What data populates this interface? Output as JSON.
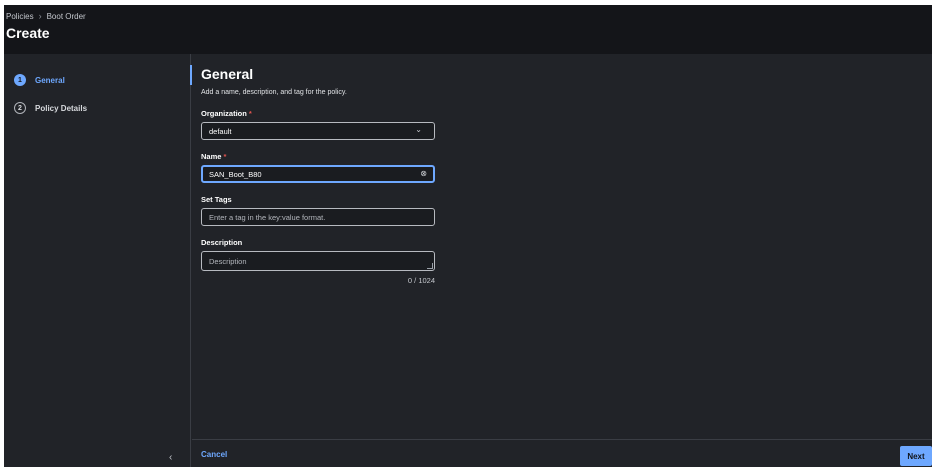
{
  "header": {
    "breadcrumb": [
      "Policies",
      "Boot Order"
    ],
    "breadcrumb_sep": "›",
    "title": "Create"
  },
  "sidebar": {
    "steps": [
      {
        "number": "1",
        "label": "General",
        "active": true
      },
      {
        "number": "2",
        "label": "Policy Details",
        "active": false
      }
    ],
    "collapse_icon": "chevron-left-icon",
    "collapse_glyph": "‹"
  },
  "main": {
    "title": "General",
    "description": "Add a name, description, and tag for the policy.",
    "organization": {
      "label": "Organization",
      "required_mark": "*",
      "value": "default",
      "icon_glyph": "⌄"
    },
    "name": {
      "label": "Name",
      "required_mark": "*",
      "value": "SAN_Boot_B80",
      "icon_glyph": "⊗"
    },
    "tags": {
      "label": "Set Tags",
      "placeholder": "Enter a tag in the key:value format."
    },
    "description_field": {
      "label": "Description",
      "placeholder": "Description",
      "counter": "0 / 1024"
    }
  },
  "footer": {
    "cancel_label": "Cancel",
    "next_label": "Next"
  },
  "colors": {
    "accent": "#6ea8ff",
    "background": "#212328",
    "header_bg": "#141519",
    "required": "#e0544f"
  }
}
